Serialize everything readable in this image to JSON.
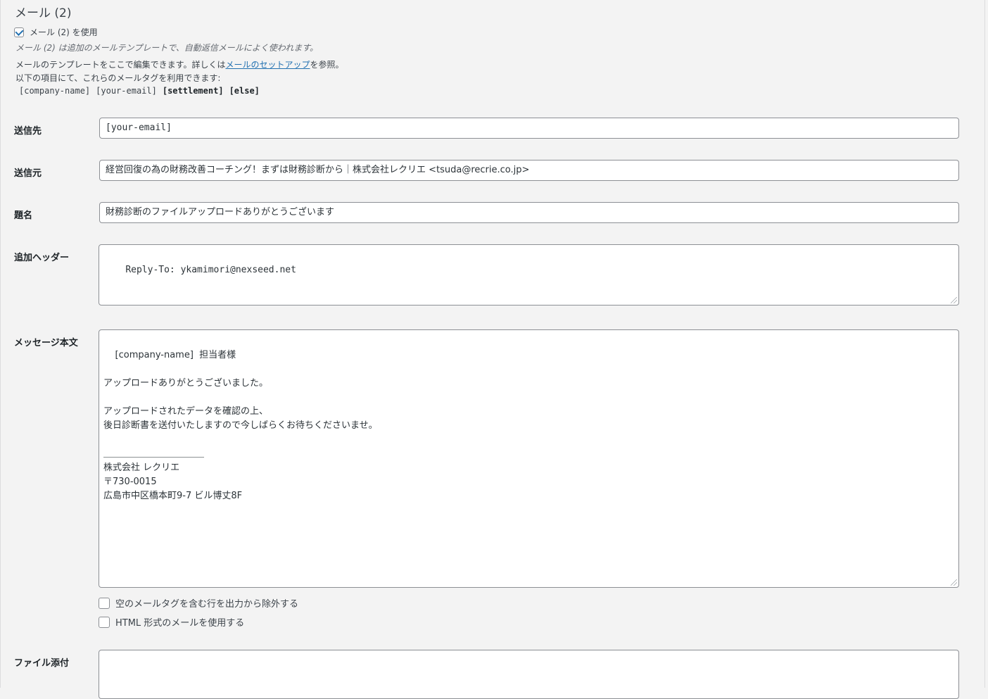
{
  "section": {
    "title": "メール (2)",
    "use_label": "メール (2) を使用",
    "use_checked": true,
    "description": "メール (2) は追加のメールテンプレートで、自動返信メールによく使われます。",
    "help_prefix": "メールのテンプレートをここで編集できます。詳しくは",
    "help_link": "メールのセットアップ",
    "help_suffix": "を参照。",
    "help_line2": "以下の項目にて、これらのメールタグを利用できます:",
    "tags": [
      "[company-name]",
      "[your-email]",
      "[settlement]",
      "[else]"
    ]
  },
  "fields": {
    "to": {
      "label": "送信先",
      "value": "[your-email]"
    },
    "from": {
      "label": "送信元",
      "value": "経営回復の為の財務改善コーチング！まずは財務診断から｜株式会社レクリエ <tsuda@recrie.co.jp>"
    },
    "subject": {
      "label": "題名",
      "value": "財務診断のファイルアップロードありがとうございます"
    },
    "headers": {
      "label": "追加ヘッダー",
      "value": "Reply-To: ykamimori@nexseed.net"
    },
    "body": {
      "label": "メッセージ本文",
      "value": "[company-name]  担当者様\n\nアップロードありがとうございました。\n\nアップロードされたデータを確認の上、\n後日診断書を送付いたしますので今しばらくお待ちくださいませ。\n\n＿＿＿＿＿＿＿＿＿＿＿\n株式会社 レクリエ\n〒730-0015\n広島市中区橋本町9-7 ビル博丈8F"
    },
    "attachments": {
      "label": "ファイル添付",
      "value": ""
    }
  },
  "options": {
    "exclude_blank": {
      "label": "空のメールタグを含む行を出力から除外する",
      "checked": false
    },
    "use_html": {
      "label": "HTML 形式のメールを使用する",
      "checked": false
    }
  }
}
